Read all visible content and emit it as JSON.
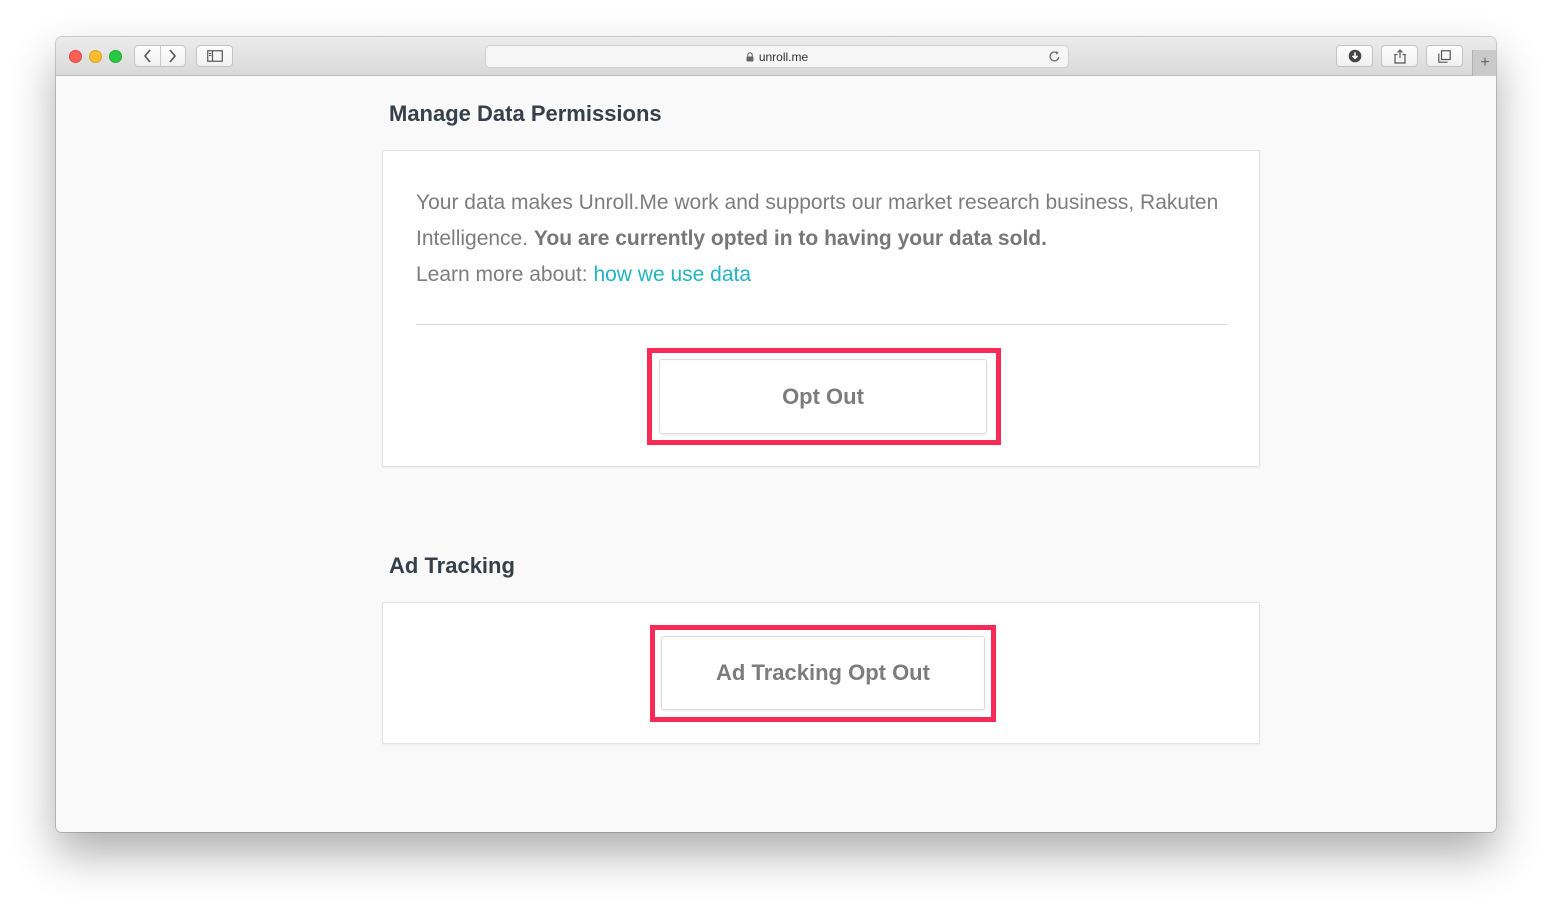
{
  "browser": {
    "url": "unroll.me",
    "icons": {
      "back": "chevron-left-icon",
      "forward": "chevron-right-icon",
      "sidebar": "sidebar-icon",
      "lock": "lock-icon",
      "reload": "reload-icon",
      "downloads": "download-icon",
      "share": "share-icon",
      "tabs": "tabs-overview-icon",
      "new_tab": "plus-icon"
    }
  },
  "data_permissions": {
    "title": "Manage Data Permissions",
    "description_plain": "Your data makes Unroll.Me work and supports our market research business, Rakuten Intelligence. ",
    "description_bold": "You are currently opted in to having your data sold.",
    "learn_more_prefix": "Learn more about: ",
    "learn_more_link": "how we use data",
    "opt_out_label": "Opt Out"
  },
  "ad_tracking": {
    "title": "Ad Tracking",
    "opt_out_label": "Ad Tracking Opt Out"
  },
  "colors": {
    "highlight": "#f72a58",
    "link": "#1fb5c3",
    "heading": "#36404a"
  }
}
